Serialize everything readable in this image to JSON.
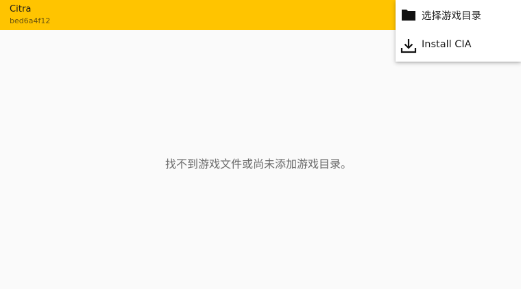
{
  "toolbar": {
    "title": "Citra",
    "subtitle": "bed6a4f12"
  },
  "main": {
    "empty_message": "找不到游戏文件或尚未添加游戏目录。"
  },
  "menu": {
    "items": [
      {
        "label": "选择游戏目录",
        "icon": "folder-icon"
      },
      {
        "label": "Install CIA",
        "icon": "download-icon"
      }
    ]
  },
  "colors": {
    "toolbar_bg": "#ffc400",
    "background": "#fafafa",
    "menu_bg": "#ffffff"
  }
}
